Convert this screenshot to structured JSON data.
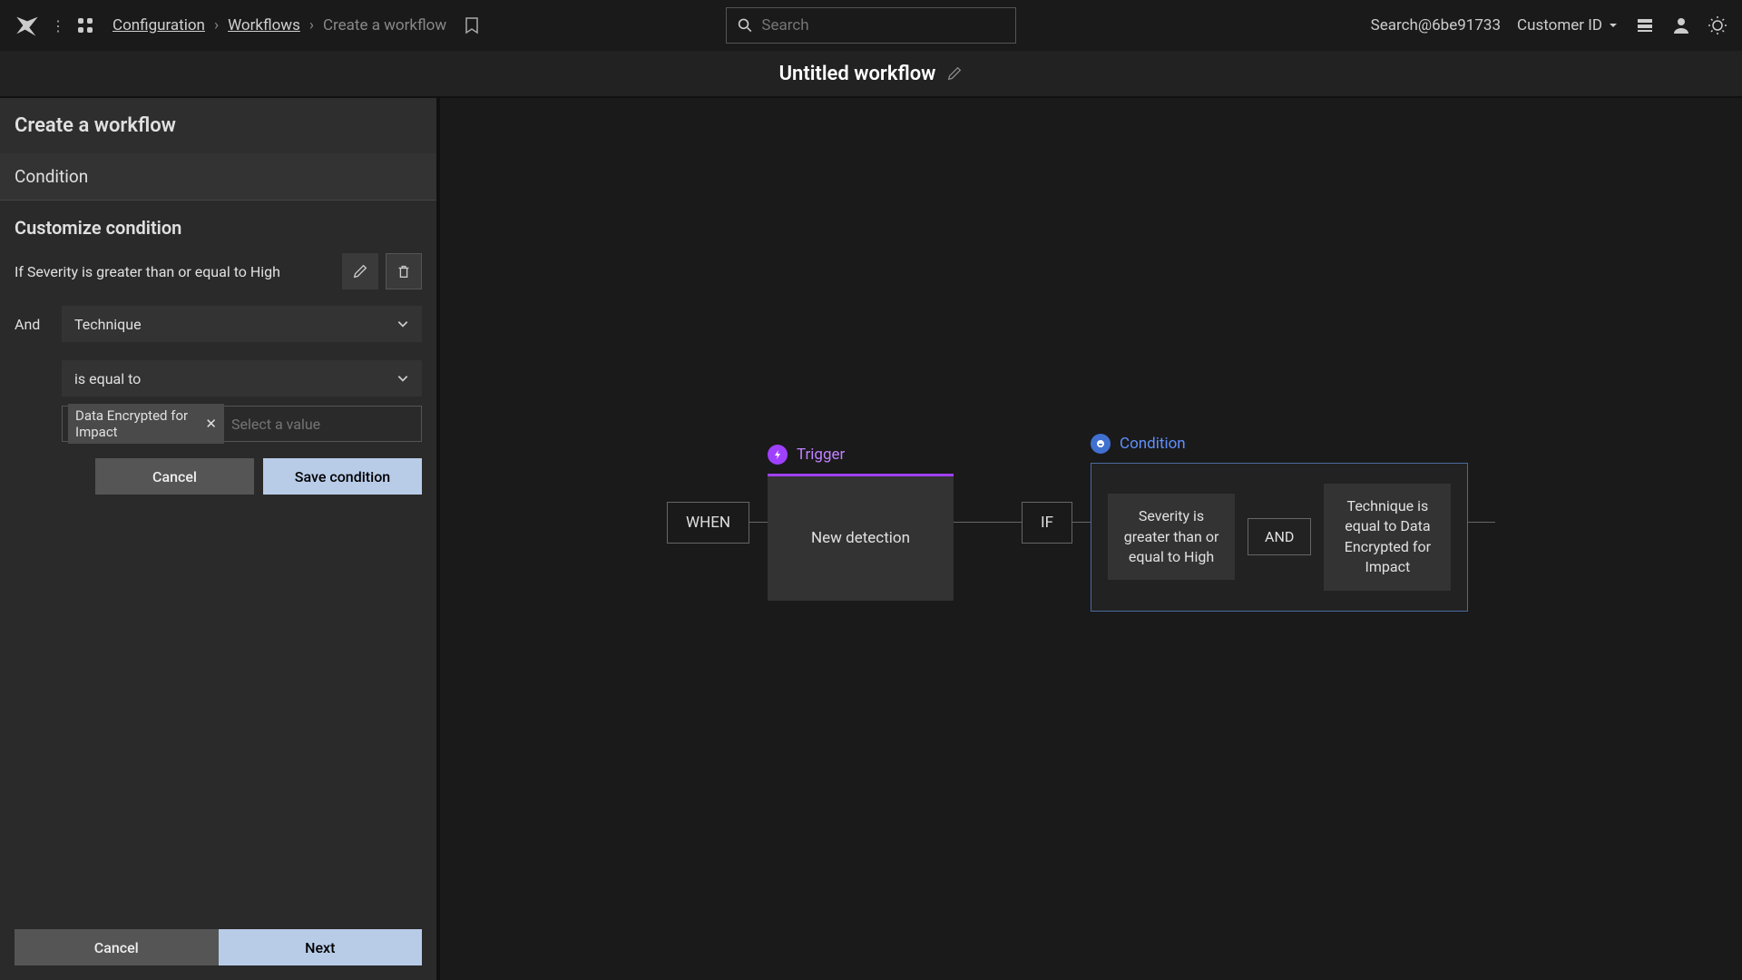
{
  "breadcrumb": {
    "l1": "Configuration",
    "l2": "Workflows",
    "current": "Create a workflow"
  },
  "search": {
    "placeholder": "Search"
  },
  "topright": {
    "user": "Search@6be91733",
    "cid": "Customer ID"
  },
  "title": "Untitled workflow",
  "sidebar": {
    "h1": "Create a workflow",
    "h2": "Condition",
    "h3": "Customize condition",
    "cond_text": "If Severity is greater than or equal to High",
    "and": "And",
    "field": "Technique",
    "op": "is equal to",
    "tag": "Data Encrypted for Impact",
    "value_ph": "Select a value",
    "cancel": "Cancel",
    "save": "Save condition",
    "footer_cancel": "Cancel",
    "footer_next": "Next"
  },
  "flow": {
    "when": "WHEN",
    "trigger_label": "Trigger",
    "trigger_body": "New detection",
    "if": "IF",
    "cond_label": "Condition",
    "block1": "Severity is greater than or equal to High",
    "and": "AND",
    "block2": "Technique is equal to Data Encrypted for Impact"
  }
}
